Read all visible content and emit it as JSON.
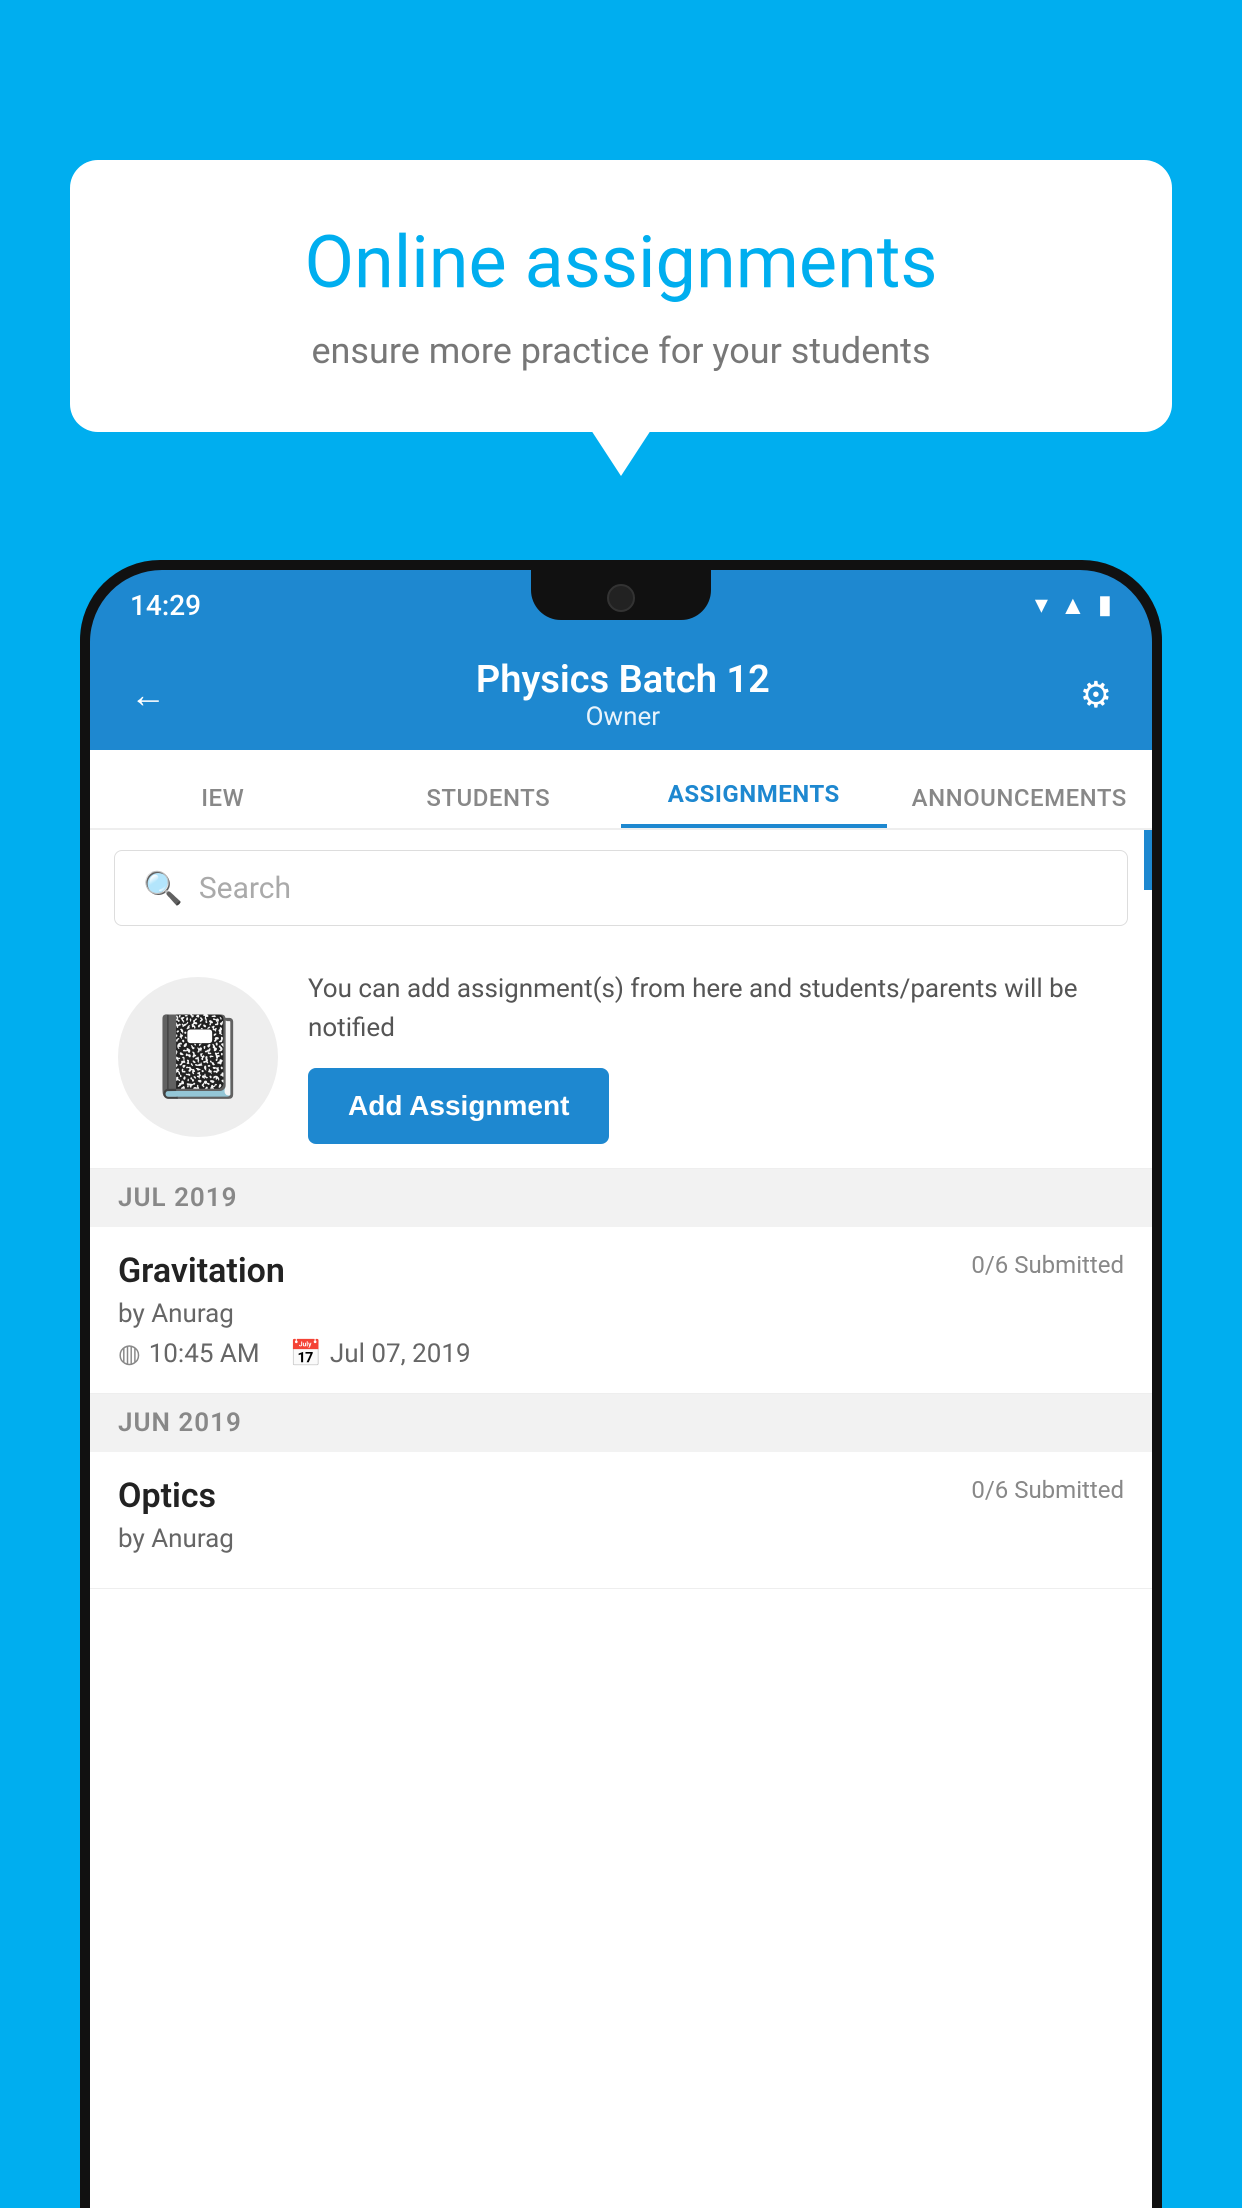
{
  "background_color": "#00AEEF",
  "speech_bubble": {
    "title": "Online assignments",
    "subtitle": "ensure more practice for your students"
  },
  "status_bar": {
    "time": "14:29",
    "wifi": "▾",
    "signal": "▲",
    "battery": "▮"
  },
  "header": {
    "title": "Physics Batch 12",
    "subtitle": "Owner",
    "back_label": "←",
    "settings_label": "⚙"
  },
  "tabs": [
    {
      "label": "IEW",
      "active": false
    },
    {
      "label": "STUDENTS",
      "active": false
    },
    {
      "label": "ASSIGNMENTS",
      "active": true
    },
    {
      "label": "ANNOUNCEMENTS",
      "active": false
    }
  ],
  "search": {
    "placeholder": "Search"
  },
  "promo": {
    "text": "You can add assignment(s) from here and students/parents will be notified",
    "button_label": "Add Assignment"
  },
  "months": [
    {
      "label": "JUL 2019",
      "assignments": [
        {
          "name": "Gravitation",
          "submitted": "0/6 Submitted",
          "by": "by Anurag",
          "time": "10:45 AM",
          "date": "Jul 07, 2019"
        }
      ]
    },
    {
      "label": "JUN 2019",
      "assignments": [
        {
          "name": "Optics",
          "submitted": "0/6 Submitted",
          "by": "by Anurag",
          "time": "",
          "date": ""
        }
      ]
    }
  ]
}
